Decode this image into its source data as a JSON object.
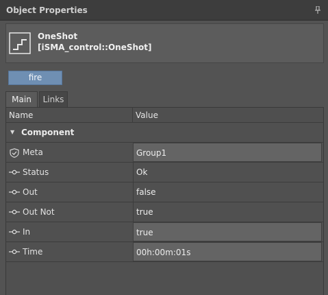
{
  "panel": {
    "title": "Object Properties"
  },
  "header": {
    "name": "OneShot",
    "type": "[iSMA_control::OneShot]"
  },
  "actions": {
    "fire_label": "fire"
  },
  "tabs": [
    {
      "label": "Main"
    },
    {
      "label": "Links"
    }
  ],
  "grid": {
    "columns": {
      "name": "Name",
      "value": "Value"
    },
    "group": "Component",
    "rows": [
      {
        "name": "Meta",
        "value": "Group1",
        "icon": "shield-icon",
        "editable": true
      },
      {
        "name": "Status",
        "value": "Ok",
        "icon": "slot-icon",
        "editable": false
      },
      {
        "name": "Out",
        "value": "false",
        "icon": "slot-icon",
        "editable": false
      },
      {
        "name": "Out Not",
        "value": "true",
        "icon": "slot-icon",
        "editable": false
      },
      {
        "name": "In",
        "value": "true",
        "icon": "slot-icon",
        "editable": true
      },
      {
        "name": "Time",
        "value": "00h:00m:01s",
        "icon": "slot-icon",
        "editable": true
      }
    ]
  },
  "colors": {
    "button": "#6f8fb3",
    "panel_bg": "#535353",
    "title_bg": "#3d3d3d"
  }
}
